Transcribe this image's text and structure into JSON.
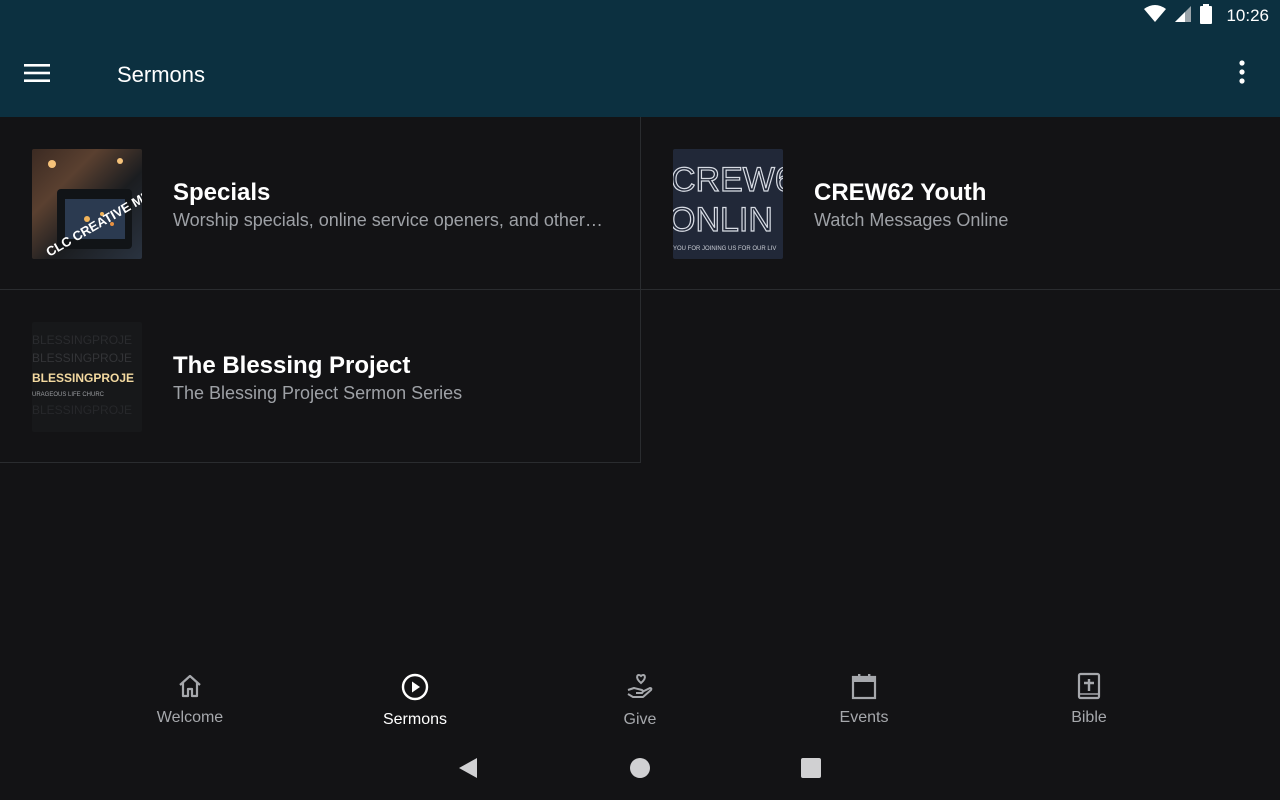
{
  "status_bar": {
    "time": "10:26"
  },
  "app_bar": {
    "title": "Sermons"
  },
  "items": [
    {
      "title": "Specials",
      "subtitle": "Worship specials, online service openers, and other…",
      "thumb_text": "CLC CREATIVE MEDIA"
    },
    {
      "title": "CREW62 Youth",
      "subtitle": "Watch Messages Online",
      "thumb_line1": "CREW6",
      "thumb_line2": "ONLIN",
      "thumb_line3": "YOU FOR JOINING US FOR OUR LIV"
    },
    {
      "title": "The Blessing Project",
      "subtitle": "The Blessing Project Sermon Series",
      "thumb_line1": "BLESSINGPROJE",
      "thumb_line2": "URAGEOUS LIFE CHURC"
    }
  ],
  "bottom_nav": [
    {
      "label": "Welcome",
      "icon": "home-icon",
      "active": false
    },
    {
      "label": "Sermons",
      "icon": "play-circle-icon",
      "active": true
    },
    {
      "label": "Give",
      "icon": "give-hand-heart-icon",
      "active": false
    },
    {
      "label": "Events",
      "icon": "calendar-icon",
      "active": false
    },
    {
      "label": "Bible",
      "icon": "bible-icon",
      "active": false
    }
  ],
  "colors": {
    "app_bar": "#0c3040",
    "background": "#131315",
    "active": "#ffffff",
    "inactive": "#a6a8ac"
  }
}
